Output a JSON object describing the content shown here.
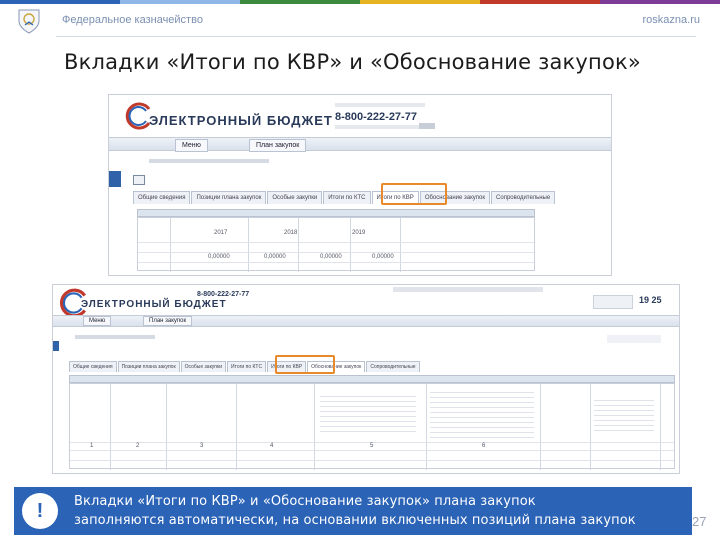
{
  "header": {
    "org_name": "Федеральное казначейство",
    "site": "roskazna.ru"
  },
  "slide": {
    "title": "Вкладки «Итоги по КВР» и «Обоснование закупок»",
    "page_number": "27"
  },
  "screenshot_top": {
    "brand": "ЭЛЕКТРОННЫЙ БЮДЖЕТ",
    "phone": "8-800-222-27-77",
    "nav_menu": "Меню",
    "nav_tab": "План закупок",
    "tabs": [
      "Общие сведения",
      "Позиции плана закупок",
      "Особые закупки",
      "Итоги по КТС",
      "Итоги по КВР",
      "Обоснование закупок",
      "Сопроводительные"
    ],
    "highlighted_tab": "Итоги по КВР",
    "grid_years": [
      "2017",
      "2018",
      "2019"
    ],
    "grid_values": [
      "0,00000",
      "0,00000",
      "0,00000",
      "0,00000"
    ]
  },
  "screenshot_bottom": {
    "brand": "ЭЛЕКТРОННЫЙ БЮДЖЕТ",
    "phone": "8-800-222-27-77",
    "nav_menu": "Меню",
    "nav_tab": "План закупок",
    "clock": "19 25",
    "tabs": [
      "Общие сведения",
      "Позиции плана закупок",
      "Особые закупки",
      "Итоги по КТС",
      "Итоги по КВР",
      "Обоснование закупок",
      "Сопроводительные"
    ],
    "highlighted_tab": "Обоснование закупок",
    "column_numbers": [
      "1",
      "2",
      "3",
      "4",
      "5",
      "6"
    ]
  },
  "note": {
    "badge": "!",
    "line1": "Вкладки «Итоги по КВР»  и  «Обоснование закупок»  плана закупок",
    "line2": "заполняются автоматически, на основании включенных позиций плана закупок"
  },
  "colors": {
    "accent_blue": "#2b63b7",
    "highlight_orange": "#e8892a"
  }
}
